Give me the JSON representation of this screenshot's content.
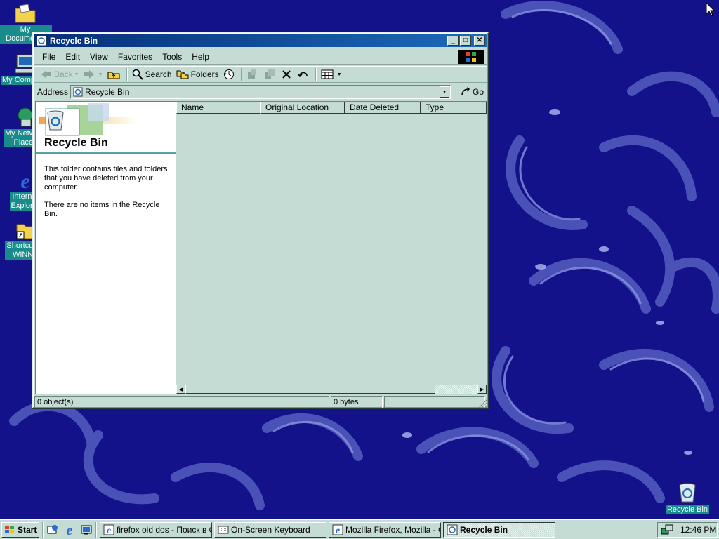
{
  "desktop": {
    "icons": [
      {
        "label": "My Documents"
      },
      {
        "label": "My Computer"
      },
      {
        "label": "My Network\nPlaces"
      },
      {
        "label": "Internet\nExplorer"
      },
      {
        "label": "Shortcut to\nWINNT"
      },
      {
        "label": "Recycle Bin"
      }
    ]
  },
  "window": {
    "title": "Recycle Bin",
    "controls": {
      "minimize": "_",
      "maximize": "□",
      "close": "✕"
    },
    "menu": [
      "File",
      "Edit",
      "View",
      "Favorites",
      "Tools",
      "Help"
    ],
    "toolbar": {
      "back": "Back",
      "search": "Search",
      "folders": "Folders"
    },
    "address": {
      "label": "Address",
      "value": "Recycle Bin",
      "go": "Go"
    },
    "left_pane": {
      "title": "Recycle Bin",
      "description": "This folder contains files and folders that you have deleted from your computer.",
      "empty_message": "There are no items in the Recycle Bin."
    },
    "columns": [
      "Name",
      "Original Location",
      "Date Deleted",
      "Type"
    ],
    "status": {
      "objects": "0 object(s)",
      "size": "0 bytes"
    }
  },
  "taskbar": {
    "start": "Start",
    "tasks": [
      {
        "label": "firefox oid dos - Поиск в G..."
      },
      {
        "label": "On-Screen Keyboard"
      },
      {
        "label": "Mozilla Firefox, Mozilla - Ст..."
      },
      {
        "label": "Recycle Bin",
        "active": true
      }
    ],
    "clock": "12:46 PM"
  },
  "colors": {
    "desktop": "#14128a",
    "window_face": "#c4dcd4",
    "title_start": "#062e78",
    "title_end": "#1c6ab8"
  }
}
